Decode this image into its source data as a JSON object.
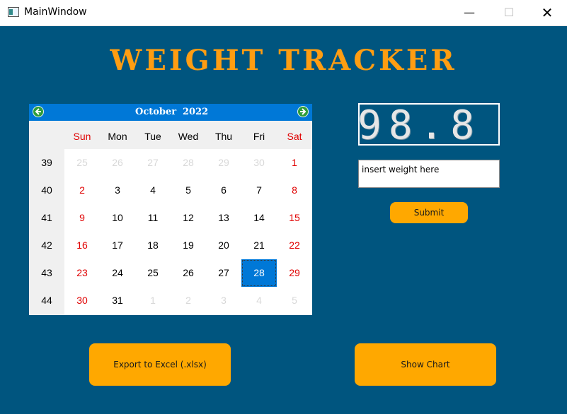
{
  "window": {
    "title": "MainWindow",
    "minimize_glyph": "—",
    "maximize_glyph": "☐",
    "close_glyph": "✕"
  },
  "heading": "WEIGHT TRACKER",
  "calendar": {
    "month": "October",
    "year": "2022",
    "day_headers": [
      "Sun",
      "Mon",
      "Tue",
      "Wed",
      "Thu",
      "Fri",
      "Sat"
    ],
    "weeks": [
      {
        "week": "39",
        "days": [
          "25",
          "26",
          "27",
          "28",
          "29",
          "30",
          "1"
        ]
      },
      {
        "week": "40",
        "days": [
          "2",
          "3",
          "4",
          "5",
          "6",
          "7",
          "8"
        ]
      },
      {
        "week": "41",
        "days": [
          "9",
          "10",
          "11",
          "12",
          "13",
          "14",
          "15"
        ]
      },
      {
        "week": "42",
        "days": [
          "16",
          "17",
          "18",
          "19",
          "20",
          "21",
          "22"
        ]
      },
      {
        "week": "43",
        "days": [
          "23",
          "24",
          "25",
          "26",
          "27",
          "28",
          "29"
        ]
      },
      {
        "week": "44",
        "days": [
          "30",
          "31",
          "1",
          "2",
          "3",
          "4",
          "5"
        ]
      }
    ],
    "selected_day": "28",
    "colors": {
      "header_bg": "#0078d7",
      "weekend": "#e00000",
      "selected_bg": "#0078d7"
    }
  },
  "display": {
    "value": "98.8"
  },
  "input": {
    "value": "insert weight here"
  },
  "buttons": {
    "submit": "Submit",
    "export": "Export to Excel (.xlsx)",
    "chart": "Show Chart"
  },
  "colors": {
    "background": "#00557f",
    "accent": "#ffa800",
    "heading": "#ff9d12"
  }
}
